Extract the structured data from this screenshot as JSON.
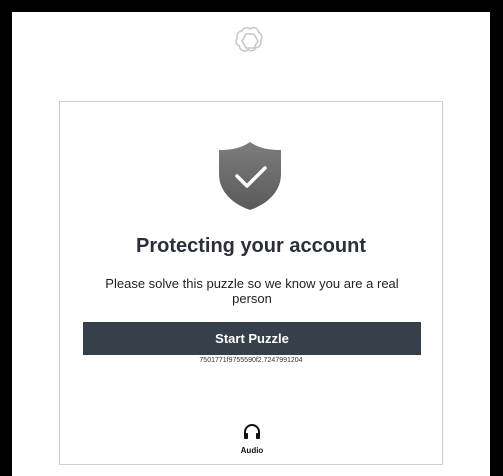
{
  "logo": {
    "icon": "openai-logo-icon"
  },
  "challenge": {
    "shield_icon": "shield-check-icon",
    "title": "Protecting your account",
    "subtitle": "Please solve this puzzle so we know you are a real person",
    "start_label": "Start Puzzle",
    "session_id": "7501771f9755590f2.7247991204",
    "audio_label": "Audio",
    "audio_icon": "headphones-icon"
  },
  "colors": {
    "button_bg": "#36404b",
    "shield_gray": "#6f6f6f",
    "title_color": "#2a2f3a"
  }
}
